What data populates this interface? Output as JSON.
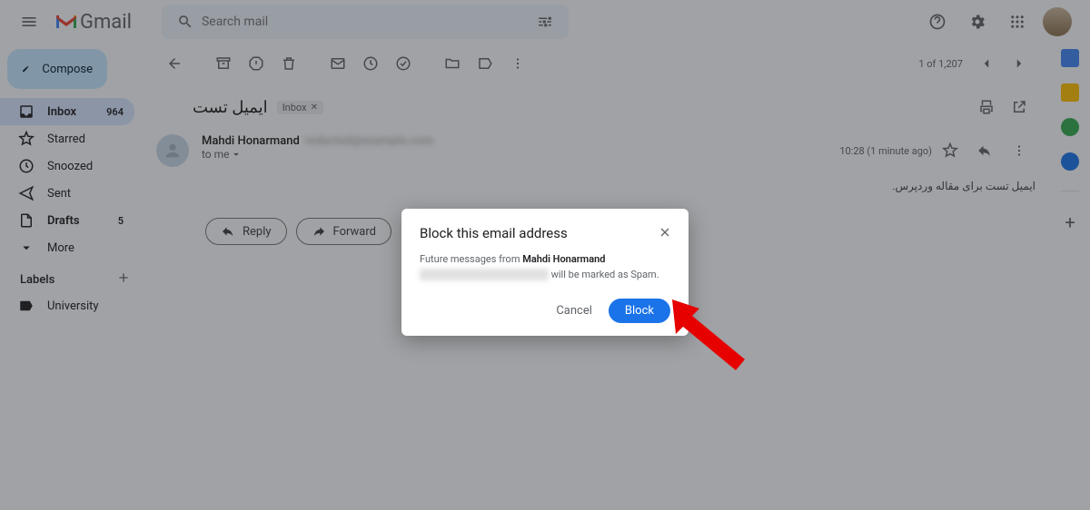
{
  "header": {
    "product_name": "Gmail",
    "search_placeholder": "Search mail"
  },
  "sidebar": {
    "compose_label": "Compose",
    "items": [
      {
        "label": "Inbox",
        "count": "964",
        "active": true,
        "icon": "inbox"
      },
      {
        "label": "Starred",
        "count": "",
        "active": false,
        "icon": "star"
      },
      {
        "label": "Snoozed",
        "count": "",
        "active": false,
        "icon": "clock"
      },
      {
        "label": "Sent",
        "count": "",
        "active": false,
        "icon": "send"
      },
      {
        "label": "Drafts",
        "count": "5",
        "active": false,
        "icon": "file",
        "bold": true
      },
      {
        "label": "More",
        "count": "",
        "active": false,
        "icon": "chevron-down"
      }
    ],
    "labels_header": "Labels",
    "labels": [
      {
        "label": "University",
        "icon": "label"
      }
    ]
  },
  "toolbar": {
    "page_count": "1 of 1,207"
  },
  "email": {
    "subject": "ایمیل تست",
    "chip_label": "Inbox",
    "sender_name": "Mahdi Honarmand",
    "sender_email_redacted": "redacted@example.com",
    "to_line": "to me",
    "timestamp": "10:28 (1 minute ago)",
    "body_text": "ایمیل تست برای مقاله وردپرس.",
    "reply_label": "Reply",
    "forward_label": "Forward"
  },
  "modal": {
    "title": "Block this email address",
    "text_prefix": "Future messages from ",
    "sender_name": "Mahdi Honarmand",
    "email_redacted": "xxxxxxxxxxxxxxxxxxxxxxxxxx",
    "text_suffix": " will be marked as Spam.",
    "cancel_label": "Cancel",
    "block_label": "Block"
  },
  "rail_colors": {
    "calendar": "#4285f4",
    "keep": "#fbbc04",
    "tasks": "#34a853",
    "contacts": "#1a73e8"
  }
}
